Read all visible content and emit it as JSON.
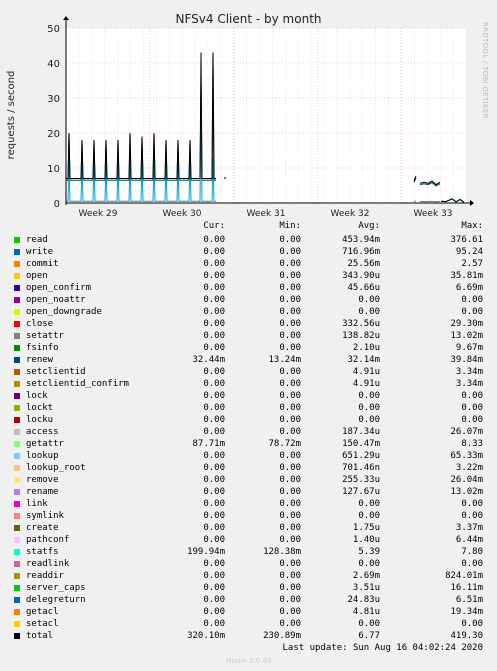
{
  "title": "NFSv4 Client - by month",
  "watermark": "RRDTOOL / TOBI OETIKER",
  "footer": {
    "last_update": "Last update:  Sun Aug 16 04:02:24 2020",
    "munin": "Munin 2.0.49"
  },
  "colors": {
    "background": "#f0f0f0",
    "plot": "#ffffff",
    "grid_major": "#e8a0a0",
    "grid_minor": "#f0c8c8",
    "frame": "#000000"
  },
  "chart_data": {
    "type": "line",
    "title": "NFSv4 Client - by month",
    "ylabel": "requests / second",
    "ylim": [
      0,
      50
    ],
    "yticks": [
      0,
      10,
      20,
      30,
      40,
      50
    ],
    "xtick_labels": [
      "Week 29",
      "Week 30",
      "Week 31",
      "Week 32",
      "Week 33"
    ],
    "grid": true,
    "series": [
      {
        "name": "renew",
        "color": "#00455c",
        "baseline": 6.5,
        "spikes": [
          20,
          18,
          18,
          18,
          18,
          20,
          19,
          20,
          18,
          18,
          18,
          35,
          43
        ]
      },
      {
        "name": "statfs",
        "color": "#00a0c0",
        "baseline": 0.5,
        "spikes": [
          13,
          12,
          12,
          12,
          12,
          12,
          12,
          12,
          12,
          12,
          13,
          26,
          13
        ]
      },
      {
        "name": "total",
        "color": "#000000",
        "baseline": 7,
        "spikes": [
          20,
          18,
          18,
          18,
          18,
          20,
          19,
          20,
          18,
          18,
          18,
          43,
          43
        ]
      }
    ]
  },
  "legend": {
    "headers": {
      "cur": "Cur:",
      "min": "Min:",
      "avg": "Avg:",
      "max": "Max:"
    },
    "rows": [
      {
        "name": "read",
        "color": "#00cc00",
        "cur": "0.00",
        "min": "0.00",
        "avg": "453.94m",
        "max": "376.61"
      },
      {
        "name": "write",
        "color": "#0066b3",
        "cur": "0.00",
        "min": "0.00",
        "avg": "716.96m",
        "max": "95.24"
      },
      {
        "name": "commit",
        "color": "#ff8000",
        "cur": "0.00",
        "min": "0.00",
        "avg": "25.56m",
        "max": "2.57"
      },
      {
        "name": "open",
        "color": "#ffcc00",
        "cur": "0.00",
        "min": "0.00",
        "avg": "343.90u",
        "max": "35.81m"
      },
      {
        "name": "open_confirm",
        "color": "#330099",
        "cur": "0.00",
        "min": "0.00",
        "avg": "45.66u",
        "max": "6.69m"
      },
      {
        "name": "open_noattr",
        "color": "#990099",
        "cur": "0.00",
        "min": "0.00",
        "avg": "0.00",
        "max": "0.00"
      },
      {
        "name": "open_downgrade",
        "color": "#ccff00",
        "cur": "0.00",
        "min": "0.00",
        "avg": "0.00",
        "max": "0.00"
      },
      {
        "name": "close",
        "color": "#ff0000",
        "cur": "0.00",
        "min": "0.00",
        "avg": "332.56u",
        "max": "29.30m"
      },
      {
        "name": "setattr",
        "color": "#808080",
        "cur": "0.00",
        "min": "0.00",
        "avg": "138.82u",
        "max": "13.02m"
      },
      {
        "name": "fsinfo",
        "color": "#008f00",
        "cur": "0.00",
        "min": "0.00",
        "avg": "2.10u",
        "max": "9.67m"
      },
      {
        "name": "renew",
        "color": "#00487d",
        "cur": "32.44m",
        "min": "13.24m",
        "avg": "32.14m",
        "max": "39.84m"
      },
      {
        "name": "setclientid",
        "color": "#b35a00",
        "cur": "0.00",
        "min": "0.00",
        "avg": "4.91u",
        "max": "3.34m"
      },
      {
        "name": "setclientid_confirm",
        "color": "#b38f00",
        "cur": "0.00",
        "min": "0.00",
        "avg": "4.91u",
        "max": "3.34m"
      },
      {
        "name": "lock",
        "color": "#6b006b",
        "cur": "0.00",
        "min": "0.00",
        "avg": "0.00",
        "max": "0.00"
      },
      {
        "name": "lockt",
        "color": "#8fb300",
        "cur": "0.00",
        "min": "0.00",
        "avg": "0.00",
        "max": "0.00"
      },
      {
        "name": "locku",
        "color": "#b30000",
        "cur": "0.00",
        "min": "0.00",
        "avg": "0.00",
        "max": "0.00"
      },
      {
        "name": "access",
        "color": "#bebebe",
        "cur": "0.00",
        "min": "0.00",
        "avg": "187.34u",
        "max": "26.07m"
      },
      {
        "name": "getattr",
        "color": "#80ff80",
        "cur": "87.71m",
        "min": "78.72m",
        "avg": "150.47m",
        "max": "8.33"
      },
      {
        "name": "lookup",
        "color": "#80c9ff",
        "cur": "0.00",
        "min": "0.00",
        "avg": "651.29u",
        "max": "65.33m"
      },
      {
        "name": "lookup_root",
        "color": "#ffc080",
        "cur": "0.00",
        "min": "0.00",
        "avg": "701.46n",
        "max": "3.22m"
      },
      {
        "name": "remove",
        "color": "#ffe680",
        "cur": "0.00",
        "min": "0.00",
        "avg": "255.33u",
        "max": "26.04m"
      },
      {
        "name": "rename",
        "color": "#aa80ff",
        "cur": "0.00",
        "min": "0.00",
        "avg": "127.67u",
        "max": "13.02m"
      },
      {
        "name": "link",
        "color": "#ee00cc",
        "cur": "0.00",
        "min": "0.00",
        "avg": "0.00",
        "max": "0.00"
      },
      {
        "name": "symlink",
        "color": "#ff8080",
        "cur": "0.00",
        "min": "0.00",
        "avg": "0.00",
        "max": "0.00"
      },
      {
        "name": "create",
        "color": "#666600",
        "cur": "0.00",
        "min": "0.00",
        "avg": "1.75u",
        "max": "3.37m"
      },
      {
        "name": "pathconf",
        "color": "#ffbfff",
        "cur": "0.00",
        "min": "0.00",
        "avg": "1.40u",
        "max": "6.44m"
      },
      {
        "name": "statfs",
        "color": "#00ffcc",
        "cur": "199.94m",
        "min": "128.38m",
        "avg": "5.39",
        "max": "7.80"
      },
      {
        "name": "readlink",
        "color": "#cc6699",
        "cur": "0.00",
        "min": "0.00",
        "avg": "0.00",
        "max": "0.00"
      },
      {
        "name": "readdir",
        "color": "#999900",
        "cur": "0.00",
        "min": "0.00",
        "avg": "2.69m",
        "max": "824.01m"
      },
      {
        "name": "server_caps",
        "color": "#00cc00",
        "cur": "0.00",
        "min": "0.00",
        "avg": "3.51u",
        "max": "16.11m"
      },
      {
        "name": "delegreturn",
        "color": "#0066b3",
        "cur": "0.00",
        "min": "0.00",
        "avg": "24.83u",
        "max": "6.51m"
      },
      {
        "name": "getacl",
        "color": "#ff8000",
        "cur": "0.00",
        "min": "0.00",
        "avg": "4.81u",
        "max": "19.34m"
      },
      {
        "name": "setacl",
        "color": "#ffcc00",
        "cur": "0.00",
        "min": "0.00",
        "avg": "0.00",
        "max": "0.00"
      },
      {
        "name": "total",
        "color": "#000000",
        "cur": "320.10m",
        "min": "230.89m",
        "avg": "6.77",
        "max": "419.30"
      }
    ]
  }
}
